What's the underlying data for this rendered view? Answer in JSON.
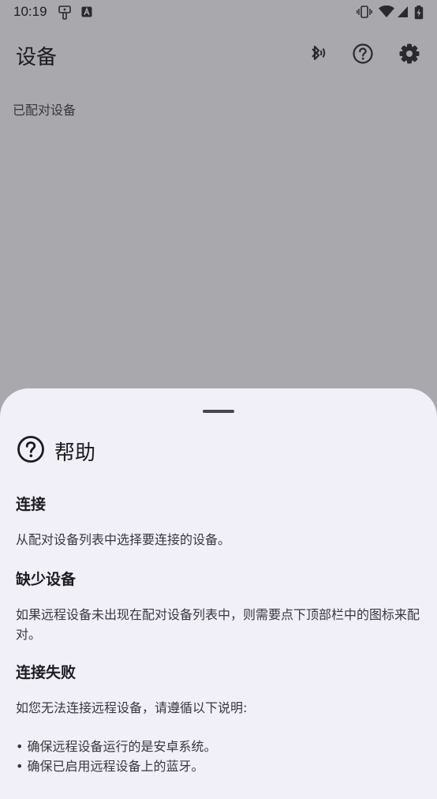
{
  "status_bar": {
    "time": "10:19",
    "icons": [
      "tethering-icon",
      "a-badge-icon",
      "vibrate-icon",
      "wifi-icon",
      "signal-icon",
      "battery-charging-icon"
    ]
  },
  "app_bar": {
    "title": "设备",
    "actions": [
      "bluetooth-search-icon",
      "help-icon",
      "settings-icon"
    ]
  },
  "paired_section_label": "已配对设备",
  "help_sheet": {
    "title": "帮助",
    "sections": [
      {
        "heading": "连接",
        "body": "从配对设备列表中选择要连接的设备。"
      },
      {
        "heading": "缺少设备",
        "body": "如果远程设备未出现在配对设备列表中，则需要点下顶部栏中的图标来配对。"
      },
      {
        "heading": "连接失败",
        "body": "如您无法连接远程设备，请遵循以下说明:",
        "bullets": [
          "• 确保远程设备运行的是安卓系统。",
          "• 确保已启用远程设备上的蓝牙。"
        ]
      }
    ]
  },
  "colors": {
    "scrim_background": "#a9a8ad",
    "sheet_background": "#f1eff8",
    "text_primary": "#1c1b1f",
    "text_secondary": "#38373d"
  }
}
